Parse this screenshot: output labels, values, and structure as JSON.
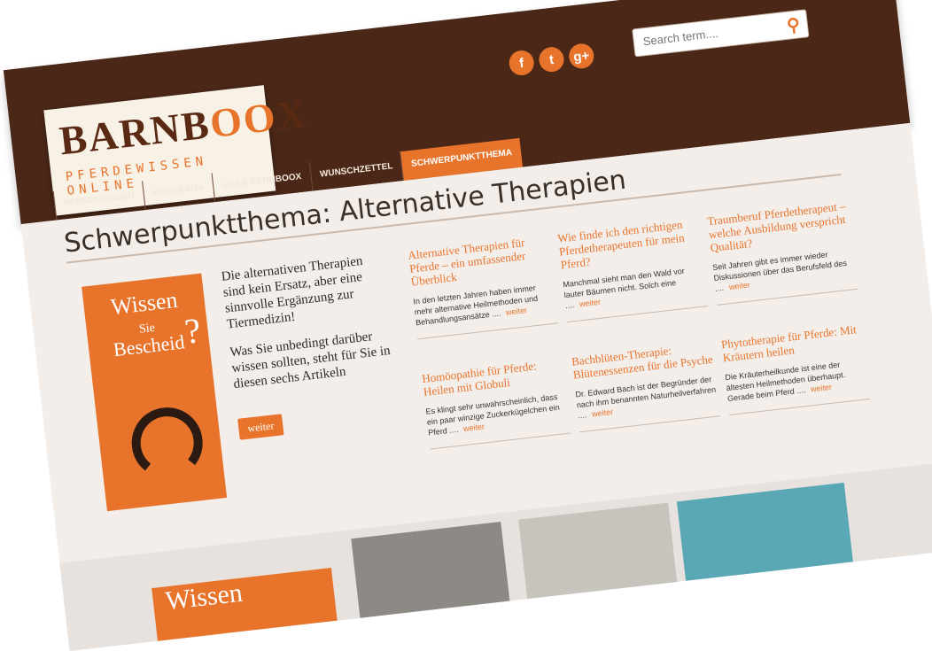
{
  "header": {
    "logo_main": "BARNB",
    "logo_oo": "OO",
    "logo_end": "X",
    "logo_sub": "PFERDEWISSEN ONLINE",
    "search_placeholder": "Search term....",
    "social": [
      "f",
      "t",
      "g+"
    ]
  },
  "nav": [
    "PFERDEWISSEN",
    "PANORAMA",
    "ÜBER BARNBOOX",
    "WUNSCHZETTEL",
    "SCHWERPUNKTTHEMA"
  ],
  "main": {
    "title": "Schwerpunktthema: Alternative Therapien",
    "promo": {
      "t1": "Wissen",
      "t2": "Sie",
      "t3": "Bescheid",
      "q": "?"
    },
    "intro_p1": "Die alternativen Therapien sind kein Ersatz, aber eine sinnvolle Ergänzung zur Tiermedizin!",
    "intro_p2": "Was Sie unbedingt darüber wissen sollten, steht für Sie in diesen sechs Artikeln",
    "intro_button": "weiter",
    "articles": [
      {
        "title": "Alternative Therapien für Pferde – ein umfassender Überblick",
        "text": "In den letzten Jahren haben immer mehr alternative Heilmethoden und Behandlungsansätze ....",
        "more": "weiter"
      },
      {
        "title": "Wie finde ich den richtigen Pferdetherapeuten für mein Pferd?",
        "text": "Manchmal sieht man den Wald vor lauter Bäumen nicht. Solch eine ....",
        "more": "weiter"
      },
      {
        "title": "Traumberuf Pferdetherapeut – welche Ausbildung verspricht Qualität?",
        "text": "Seit Jahren gibt es immer wieder Diskussionen über das Berufsfeld des ....",
        "more": "weiter"
      },
      {
        "title": "Homöopathie für Pferde: Heilen mit Globuli",
        "text": "Es klingt sehr unwahrscheinlich, dass ein paar winzige Zuckerkügelchen ein Pferd ....",
        "more": "weiter"
      },
      {
        "title": "Bachblüten-Therapie: Blütenessenzen für die Psyche",
        "text": "Dr. Edward Bach ist der Begründer der nach ihm benannten Naturheilverfahren ....",
        "more": "weiter"
      },
      {
        "title": "Phytotherapie für Pferde: Mit Kräutern heilen",
        "text": "Die Kräuterheilkunde ist eine der ältesten Heilmethoden überhaupt. Gerade beim Pferd ....",
        "more": "weiter"
      }
    ],
    "strip_title": "Wissen"
  }
}
